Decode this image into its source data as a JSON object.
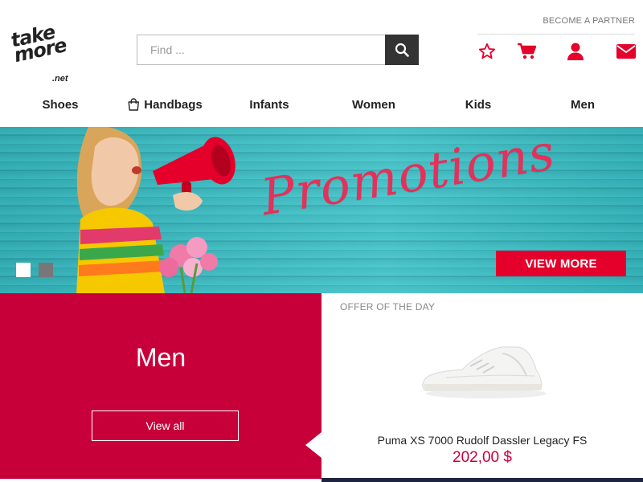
{
  "brand": {
    "logo_text": "take\nmore",
    "logo_sub": ".net"
  },
  "search": {
    "placeholder": "Find ...",
    "value": "",
    "icon": "search-icon"
  },
  "top_links": {
    "become_partner": "BECOME A PARTNER"
  },
  "header_icons": [
    "star-icon",
    "cart-icon",
    "user-icon",
    "envelope-icon"
  ],
  "nav": {
    "items": [
      {
        "label": "Shoes"
      },
      {
        "label": "Handbags",
        "icon": "handbag-icon"
      },
      {
        "label": "Infants"
      },
      {
        "label": "Women"
      },
      {
        "label": "Kids"
      },
      {
        "label": "Men"
      }
    ]
  },
  "hero": {
    "headline": "Promotions",
    "cta": "VIEW MORE",
    "slides": 2,
    "active_slide": 1
  },
  "category_panel": {
    "title": "Men",
    "cta": "View all"
  },
  "offer": {
    "label": "OFFER OF THE DAY",
    "product_name": "Puma XS 7000 Rudolf Dassler Legacy FS",
    "price": "202,00 $"
  },
  "colors": {
    "accent_red": "#e4002b",
    "panel_crimson": "#c8003a",
    "search_button": "#333333",
    "hero_teal": "#3fc3c9",
    "footer_navy": "#1d2440"
  }
}
